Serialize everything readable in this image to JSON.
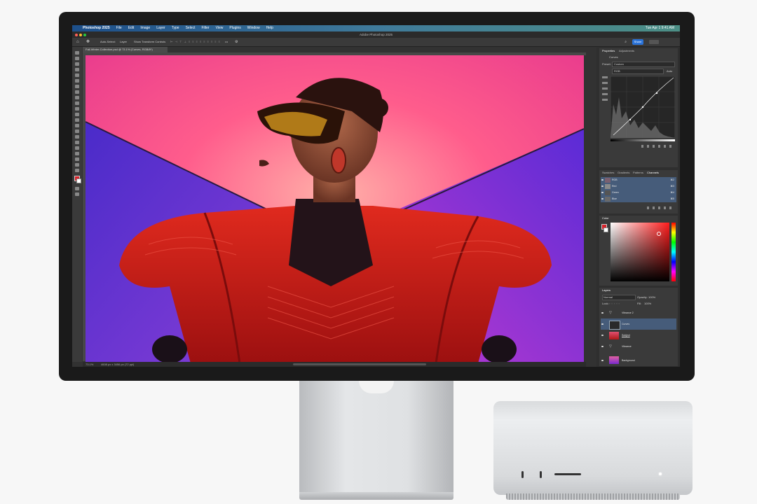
{
  "menubar": {
    "apple": "",
    "items": [
      "Photoshop 2025",
      "File",
      "Edit",
      "Image",
      "Layer",
      "Type",
      "Select",
      "Filter",
      "View",
      "Plugins",
      "Window",
      "Help"
    ],
    "clock": "Tue Apr 1  9:41 AM"
  },
  "window": {
    "title": "Adobe Photoshop 2025"
  },
  "options": {
    "auto_select": "Auto-Select:",
    "layer_dropdown": "Layer",
    "show_transform": "Show Transform Controls",
    "more": "•••",
    "share": "Share"
  },
  "document": {
    "tab": "Fall-Winter-Collection.psd @ 73.1% (Curves, RGB/8*)",
    "zoom": "73.1%",
    "info": "4608 px x 3456 px (72 ppi)"
  },
  "properties": {
    "tabs": [
      "Properties",
      "Adjustments"
    ],
    "title": "Curves",
    "preset_label": "Preset:",
    "preset_value": "Custom",
    "channel_value": "RGB",
    "auto": "Auto"
  },
  "channels": {
    "tabs": [
      "Swatches",
      "Gradients",
      "Patterns",
      "Channels"
    ],
    "rows": [
      {
        "name": "RGB",
        "shortcut": "⌘2"
      },
      {
        "name": "Red",
        "shortcut": "⌘3"
      },
      {
        "name": "Green",
        "shortcut": "⌘4"
      },
      {
        "name": "Blue",
        "shortcut": "⌘5"
      }
    ]
  },
  "color": {
    "title": "Color"
  },
  "layers": {
    "title": "Layers",
    "blend_mode": "Normal",
    "opacity_label": "Opacity:",
    "opacity": "100%",
    "lock_label": "Lock:",
    "fill_label": "Fill:",
    "fill": "100%",
    "rows": [
      "Vibrance 2",
      "Curves",
      "Subject",
      "Vibrance",
      "Brightness/Contrast",
      "Background"
    ]
  },
  "colors": {
    "accent": "#2b73d8",
    "selected_row": "#465c7a",
    "menubar": "#1d4f8a"
  }
}
